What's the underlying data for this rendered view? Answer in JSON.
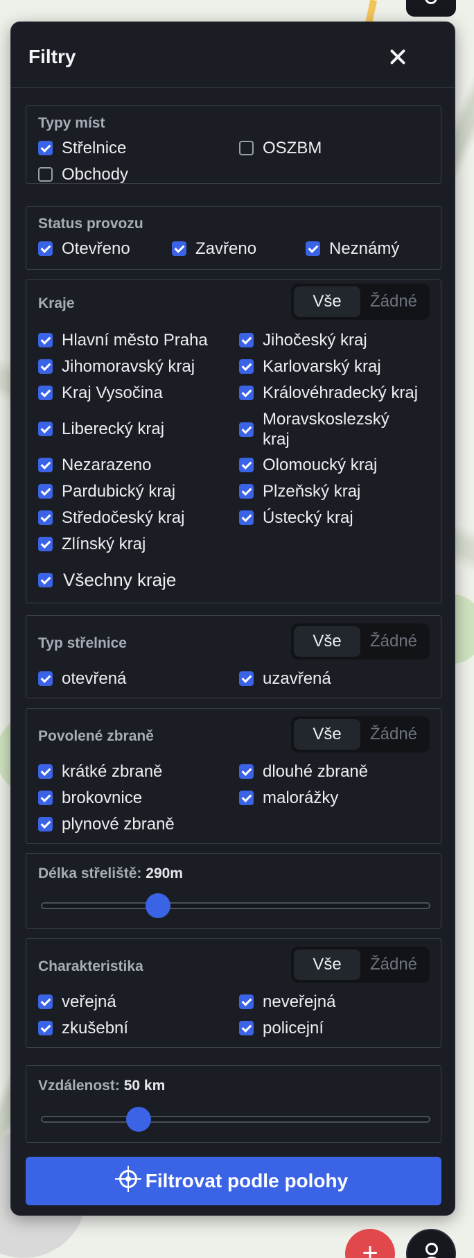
{
  "panel": {
    "title": "Filtry"
  },
  "segment": {
    "all": "Vše",
    "none": "Žádné"
  },
  "place_types": {
    "title": "Typy míst",
    "items": [
      {
        "label": "Střelnice",
        "checked": true
      },
      {
        "label": "OSZBM",
        "checked": false
      },
      {
        "label": "Obchody",
        "checked": false
      }
    ]
  },
  "status": {
    "title": "Status provozu",
    "items": [
      {
        "label": "Otevřeno",
        "checked": true
      },
      {
        "label": "Zavřeno",
        "checked": true
      },
      {
        "label": "Neznámý",
        "checked": true
      }
    ]
  },
  "regions": {
    "title": "Kraje",
    "items": [
      {
        "label": "Hlavní město Praha",
        "checked": true
      },
      {
        "label": "Jihočeský kraj",
        "checked": true
      },
      {
        "label": "Jihomoravský kraj",
        "checked": true
      },
      {
        "label": "Karlovarský kraj",
        "checked": true
      },
      {
        "label": "Kraj Vysočina",
        "checked": true
      },
      {
        "label": "Královéhradecký kraj",
        "checked": true
      },
      {
        "label": "Liberecký kraj",
        "checked": true
      },
      {
        "label": "Moravskoslezský kraj",
        "checked": true
      },
      {
        "label": "Nezarazeno",
        "checked": true
      },
      {
        "label": "Olomoucký kraj",
        "checked": true
      },
      {
        "label": "Pardubický kraj",
        "checked": true
      },
      {
        "label": "Plzeňský kraj",
        "checked": true
      },
      {
        "label": "Středočeský kraj",
        "checked": true
      },
      {
        "label": "Ústecký kraj",
        "checked": true
      },
      {
        "label": "Zlínský kraj",
        "checked": true
      }
    ],
    "all_label": "Všechny kraje",
    "all_checked": true
  },
  "range_type": {
    "title": "Typ střelnice",
    "items": [
      {
        "label": "otevřená",
        "checked": true
      },
      {
        "label": "uzavřená",
        "checked": true
      }
    ]
  },
  "weapons": {
    "title": "Povolené zbraně",
    "items": [
      {
        "label": "krátké zbraně",
        "checked": true
      },
      {
        "label": "dlouhé zbraně",
        "checked": true
      },
      {
        "label": "brokovnice",
        "checked": true
      },
      {
        "label": "malorážky",
        "checked": true
      },
      {
        "label": "plynové zbraně",
        "checked": true
      }
    ]
  },
  "length": {
    "label": "Délka střeliště:",
    "value_text": "290m",
    "fraction": 0.3
  },
  "characteristics": {
    "title": "Charakteristika",
    "items": [
      {
        "label": "veřejná",
        "checked": true
      },
      {
        "label": "neveřejná",
        "checked": true
      },
      {
        "label": "zkušební",
        "checked": true
      },
      {
        "label": "policejní",
        "checked": true
      }
    ]
  },
  "distance": {
    "label": "Vzdálenost:",
    "value_text": "50 km",
    "fraction": 0.25
  },
  "location_button": {
    "label": "Filtrovat podle polohy",
    "icon": "crosshair-icon"
  },
  "colors": {
    "accent": "#3b63e6",
    "panel": "#1a1d23",
    "fab_red": "#e0484b"
  }
}
